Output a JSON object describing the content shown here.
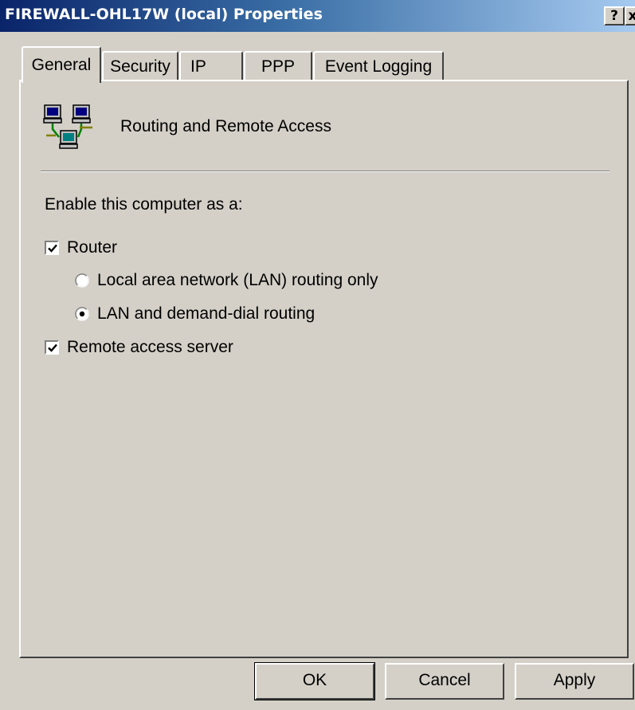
{
  "window": {
    "title": "FIREWALL-OHL17W (local) Properties",
    "help_label": "?",
    "close_label": "x"
  },
  "tabs": [
    {
      "label": "General",
      "selected": true
    },
    {
      "label": "Security",
      "selected": false
    },
    {
      "label": "IP",
      "selected": false
    },
    {
      "label": "PPP",
      "selected": false
    },
    {
      "label": "Event Logging",
      "selected": false
    }
  ],
  "general": {
    "icon": "network-computers-icon",
    "heading": "Routing and Remote Access",
    "enable_label": "Enable this computer as a:",
    "router": {
      "label": "Router",
      "checked": true
    },
    "lan_only": {
      "label": "Local area network (LAN) routing only",
      "selected": false
    },
    "lan_demand": {
      "label": "LAN and demand-dial routing",
      "selected": true
    },
    "remote_access": {
      "label": "Remote access server",
      "checked": true
    }
  },
  "buttons": {
    "ok": "OK",
    "cancel": "Cancel",
    "apply": "Apply"
  },
  "colors": {
    "titlebar_start": "#0a246a",
    "titlebar_end": "#a6caf0",
    "face": "#d4d0c8"
  }
}
